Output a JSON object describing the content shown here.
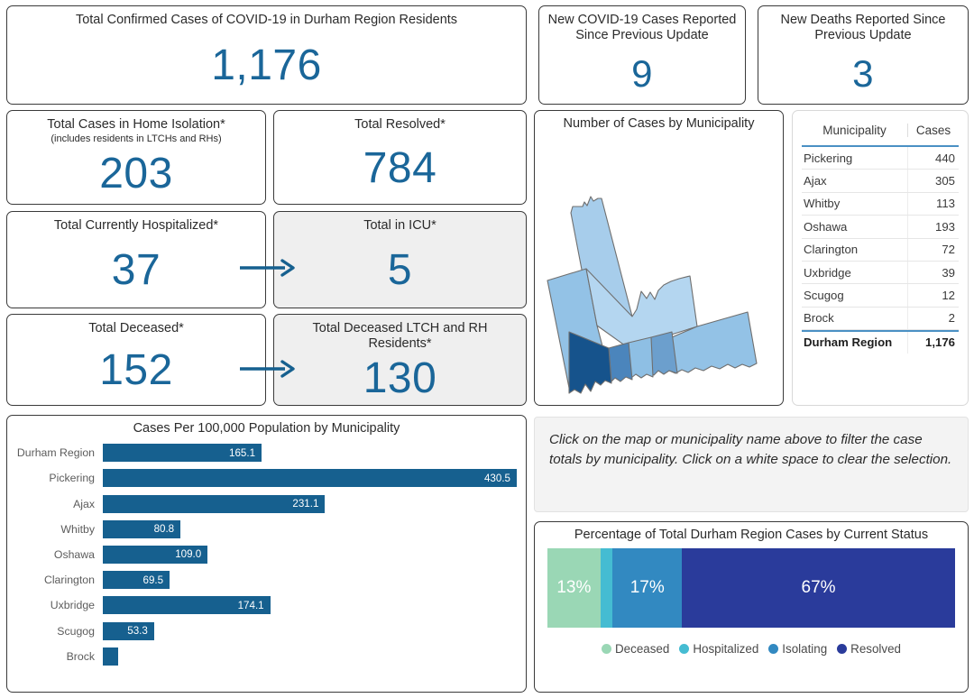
{
  "kpis": {
    "total_confirmed": {
      "title": "Total Confirmed Cases of COVID-19 in Durham Region Residents",
      "value": "1,176"
    },
    "new_cases": {
      "title": "New COVID-19 Cases Reported Since Previous Update",
      "value": "9"
    },
    "new_deaths": {
      "title": "New Deaths Reported Since Previous Update",
      "value": "3"
    },
    "home_isolation": {
      "title": "Total Cases in Home Isolation*",
      "subtitle": "(includes residents in LTCHs and RHs)",
      "value": "203"
    },
    "resolved": {
      "title": "Total Resolved*",
      "value": "784"
    },
    "hospitalized": {
      "title": "Total Currently Hospitalized*",
      "value": "37"
    },
    "icu": {
      "title": "Total in ICU*",
      "value": "5"
    },
    "deceased": {
      "title": "Total Deceased*",
      "value": "152"
    },
    "deceased_ltch": {
      "title": "Total Deceased LTCH and RH Residents*",
      "value": "130"
    }
  },
  "map_panel": {
    "title": "Number of Cases by Municipality"
  },
  "table": {
    "columns": [
      "Municipality",
      "Cases"
    ],
    "rows": [
      {
        "municipality": "Pickering",
        "cases": "440"
      },
      {
        "municipality": "Ajax",
        "cases": "305"
      },
      {
        "municipality": "Whitby",
        "cases": "113"
      },
      {
        "municipality": "Oshawa",
        "cases": "193"
      },
      {
        "municipality": "Clarington",
        "cases": "72"
      },
      {
        "municipality": "Uxbridge",
        "cases": "39"
      },
      {
        "municipality": "Scugog",
        "cases": "12"
      },
      {
        "municipality": "Brock",
        "cases": "2"
      }
    ],
    "total": {
      "municipality": "Durham Region",
      "cases": "1,176"
    }
  },
  "note": {
    "text": "Click on the map or municipality name above to filter the case totals by municipality. Click on a white space to clear the selection."
  },
  "chart_data": [
    {
      "type": "bar",
      "orientation": "horizontal",
      "title": "Cases Per 100,000 Population by Municipality",
      "xlabel": "",
      "ylabel": "",
      "grid": false,
      "xlim": [
        0,
        430.5
      ],
      "categories": [
        "Durham Region",
        "Pickering",
        "Ajax",
        "Whitby",
        "Oshawa",
        "Clarington",
        "Uxbridge",
        "Scugog",
        "Brock"
      ],
      "values": [
        165.1,
        430.5,
        231.1,
        80.8,
        109.0,
        69.5,
        174.1,
        53.3,
        16.0
      ],
      "labels": [
        "165.1",
        "430.5",
        "231.1",
        "80.8",
        "109.0",
        "69.5",
        "174.1",
        "53.3",
        ""
      ],
      "bar_color": "#16608f"
    },
    {
      "type": "bar",
      "orientation": "horizontal-stacked",
      "title": "Percentage of Total Durham Region Cases by Current Status",
      "legend_position": "bottom",
      "categories": [
        "Deceased",
        "Hospitalized",
        "Isolating",
        "Resolved"
      ],
      "values": [
        13,
        3,
        17,
        67
      ],
      "labels": [
        "13%",
        "",
        "17%",
        "67%"
      ],
      "colors": [
        "#9ad7b5",
        "#45bcd2",
        "#3289c1",
        "#2a3b9b"
      ]
    }
  ],
  "colors": {
    "accent_number": "#1a6699",
    "bar_blue": "#16608f",
    "table_rule": "#4a90c4",
    "map_stroke": "#6f6f6f"
  },
  "map_regions": [
    {
      "name": "Brock",
      "fill": "#a7cdeb"
    },
    {
      "name": "Uxbridge",
      "fill": "#93c2e6"
    },
    {
      "name": "Scugog",
      "fill": "#b4d6f0"
    },
    {
      "name": "Clarington",
      "fill": "#93c2e6"
    },
    {
      "name": "Pickering",
      "fill": "#16538c"
    },
    {
      "name": "Ajax",
      "fill": "#4b85bc"
    },
    {
      "name": "Whitby",
      "fill": "#8ebfe4"
    },
    {
      "name": "Oshawa",
      "fill": "#6c9fcd"
    }
  ]
}
